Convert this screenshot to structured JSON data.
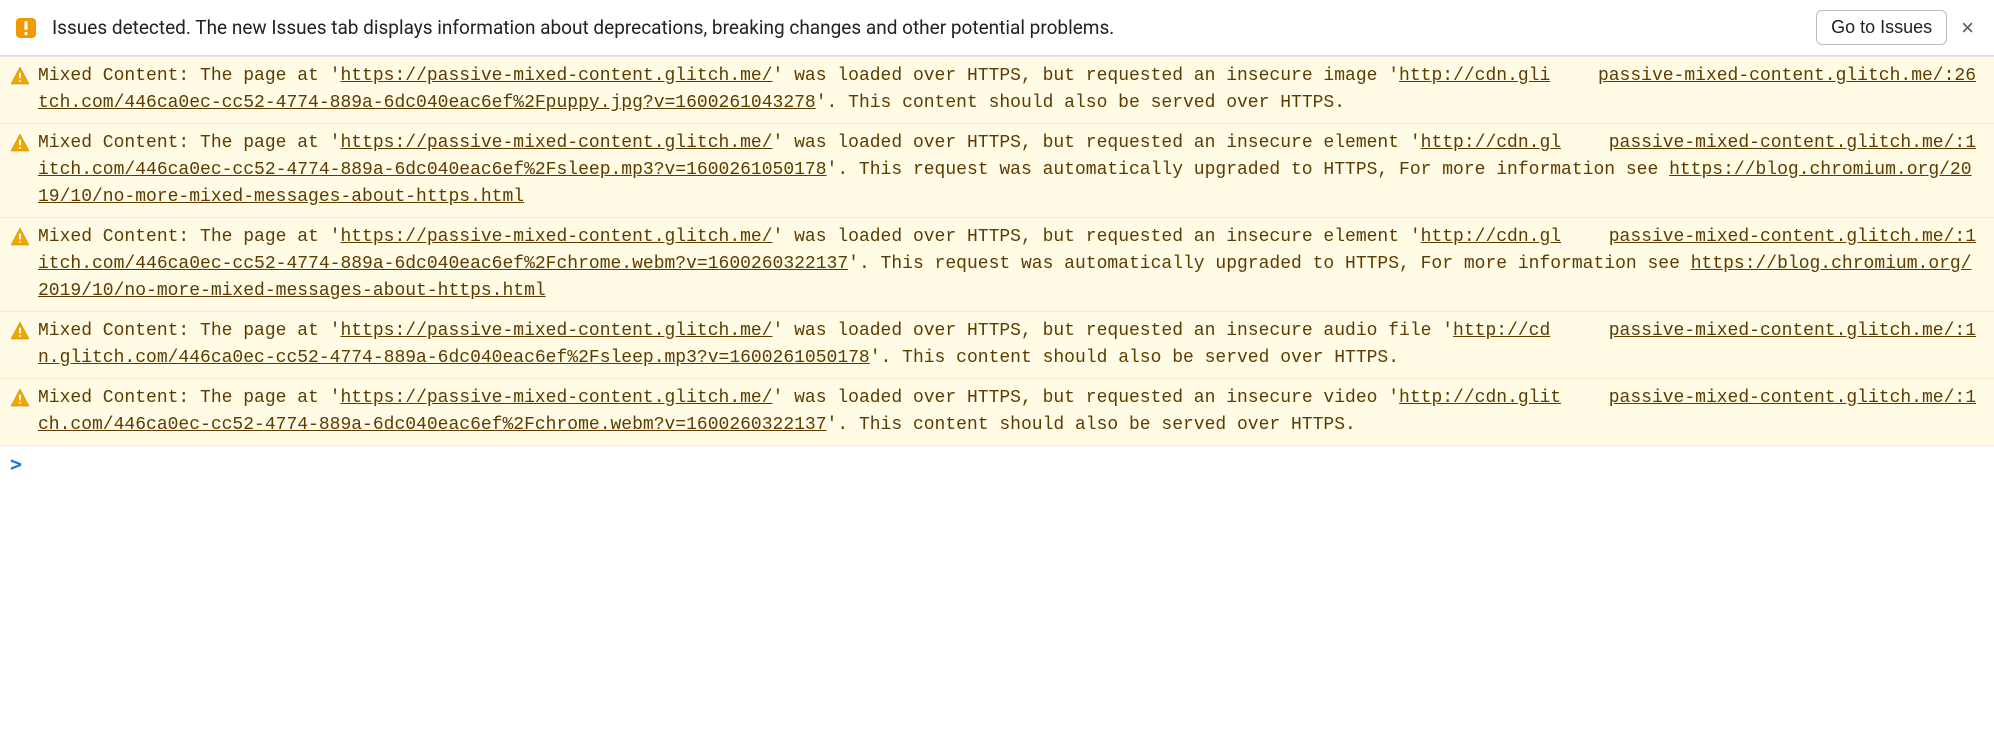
{
  "issues_bar": {
    "text": "Issues detected. The new Issues tab displays information about deprecations, breaking changes and other potential problems.",
    "go_to_issues_label": "Go to Issues",
    "close_label": "×"
  },
  "page_url": "https://passive-mixed-content.glitch.me/",
  "source_host": "passive-mixed-content.glitch.me/",
  "messages": [
    {
      "source_line": 26,
      "pre": "Mixed Content: The page at '",
      "mid1": "' was loaded over HTTPS, but requested an insecure image '",
      "resource_url": "http://cdn.glitch.com/446ca0ec-cc52-4774-889a-6dc040eac6ef%2Fpuppy.jpg?v=1600261043278",
      "post": "'. This content should also be served over HTTPS."
    },
    {
      "source_line": 1,
      "pre": "Mixed Content: The page at '",
      "mid1": "' was loaded over HTTPS, but requested an insecure element '",
      "resource_url": "http://cdn.glitch.com/446ca0ec-cc52-4774-889a-6dc040eac6ef%2Fsleep.mp3?v=1600261050178",
      "mid2": "'. This request was automatically upgraded to HTTPS, For more information see ",
      "more_info_url": "https://blog.chromium.org/2019/10/no-more-mixed-messages-about-https.html"
    },
    {
      "source_line": 1,
      "pre": "Mixed Content: The page at '",
      "mid1": "' was loaded over HTTPS, but requested an insecure element '",
      "resource_url": "http://cdn.glitch.com/446ca0ec-cc52-4774-889a-6dc040eac6ef%2Fchrome.webm?v=1600260322137",
      "mid2": "'. This request was automatically upgraded to HTTPS, For more information see ",
      "more_info_url": "https://blog.chromium.org/2019/10/no-more-mixed-messages-about-https.html"
    },
    {
      "source_line": 1,
      "pre": "Mixed Content: The page at '",
      "mid1": "' was loaded over HTTPS, but requested an insecure audio file '",
      "resource_url": "http://cdn.glitch.com/446ca0ec-cc52-4774-889a-6dc040eac6ef%2Fsleep.mp3?v=1600261050178",
      "post": "'. This content should also be served over HTTPS."
    },
    {
      "source_line": 1,
      "pre": "Mixed Content: The page at '",
      "mid1": "' was loaded over HTTPS, but requested an insecure video '",
      "resource_url": "http://cdn.glitch.com/446ca0ec-cc52-4774-889a-6dc040eac6ef%2Fchrome.webm?v=1600260322137",
      "post": "'. This content should also be served over HTTPS."
    }
  ],
  "prompt_symbol": ">"
}
